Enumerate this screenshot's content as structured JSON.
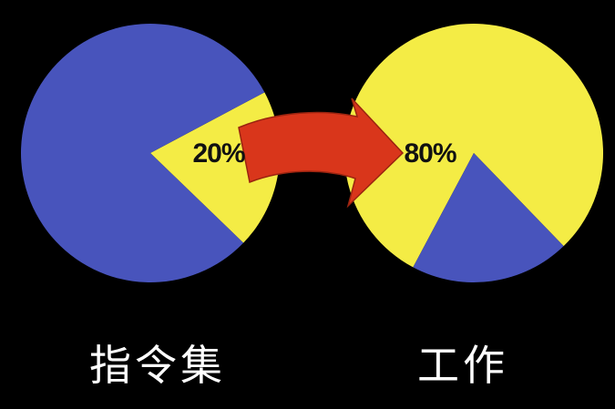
{
  "chart_data": [
    {
      "type": "pie",
      "title": "",
      "caption": "指令集",
      "slices": [
        {
          "label": "20%",
          "value": 20,
          "color": "#f4ec45"
        },
        {
          "label": "",
          "value": 80,
          "color": "#4854bc"
        }
      ]
    },
    {
      "type": "pie",
      "title": "",
      "caption": "工作",
      "slices": [
        {
          "label": "80%",
          "value": 80,
          "color": "#f4ec45"
        },
        {
          "label": "",
          "value": 20,
          "color": "#4854bc"
        }
      ]
    }
  ],
  "colors": {
    "background": "#000000",
    "blue": "#4854bc",
    "yellow": "#f4ec45",
    "arrow": "#d9361b"
  },
  "icons": {
    "connector": "arrow-right-icon"
  }
}
